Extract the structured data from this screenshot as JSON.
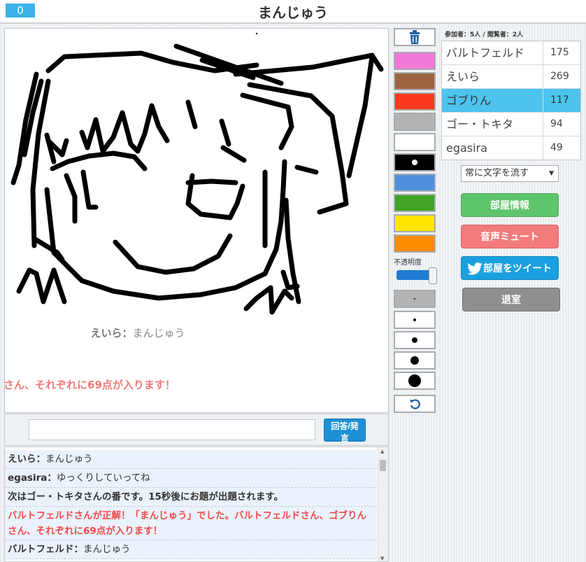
{
  "header": {
    "counter": "0",
    "title": "まんじゅう"
  },
  "canvas": {
    "answer_name": "えいら：",
    "answer_text": "まんじゅう",
    "ticker": "さん、それぞれに69点が入ります！"
  },
  "input": {
    "value": "",
    "send_label": "回答/発言"
  },
  "chat": [
    {
      "name": "えいら：",
      "text": "まんじゅう"
    },
    {
      "name": "egasira：",
      "text": "ゆっくりしていってね"
    },
    {
      "name": "",
      "text": "次はゴー・トキタさんの番です。15秒後にお題が出題されます。"
    },
    {
      "name": "",
      "text": "バルトフェルドさんが正解！「まんじゅう」でした。バルトフェルドさん、ゴブりんさん、それぞれに69点が入ります！"
    },
    {
      "name": "バルトフェルド：",
      "text": "まんじゅう"
    }
  ],
  "tools": {
    "colors": [
      "#f07ad6",
      "#9e6340",
      "#fa3a1e",
      "#b3b3b3",
      "#ffffff",
      "#000000",
      "#4f8fdd",
      "#40a326",
      "#ffe600",
      "#fb8c00"
    ],
    "selected_color": "#000000",
    "opacity_label": "不透明度",
    "opacity": 1.0,
    "sizes": [
      2,
      4,
      8,
      12,
      18
    ],
    "icons": {
      "trash": "trash-icon",
      "undo": "undo-icon",
      "twitter": "twitter-bird-icon"
    }
  },
  "room": {
    "info": "参加者：5人 / 閲覧者：2人",
    "players": [
      {
        "name": "バルトフェルド",
        "score": "175",
        "active": false
      },
      {
        "name": "えいら",
        "score": "269",
        "active": false
      },
      {
        "name": "ゴブりん",
        "score": "117",
        "active": true
      },
      {
        "name": "ゴー・トキタ",
        "score": "94",
        "active": false
      },
      {
        "name": "egasira",
        "score": "49",
        "active": false
      }
    ],
    "select_value": "常に文字を流す",
    "buttons": {
      "info": "部屋情報",
      "mute": "音声ミュート",
      "tweet": "部屋をツイート",
      "leave": "退室"
    },
    "colors": {
      "info": "#5fc56b",
      "mute": "#f27c7c",
      "tweet": "#1aa0e0",
      "leave": "#8f8f8f"
    }
  }
}
